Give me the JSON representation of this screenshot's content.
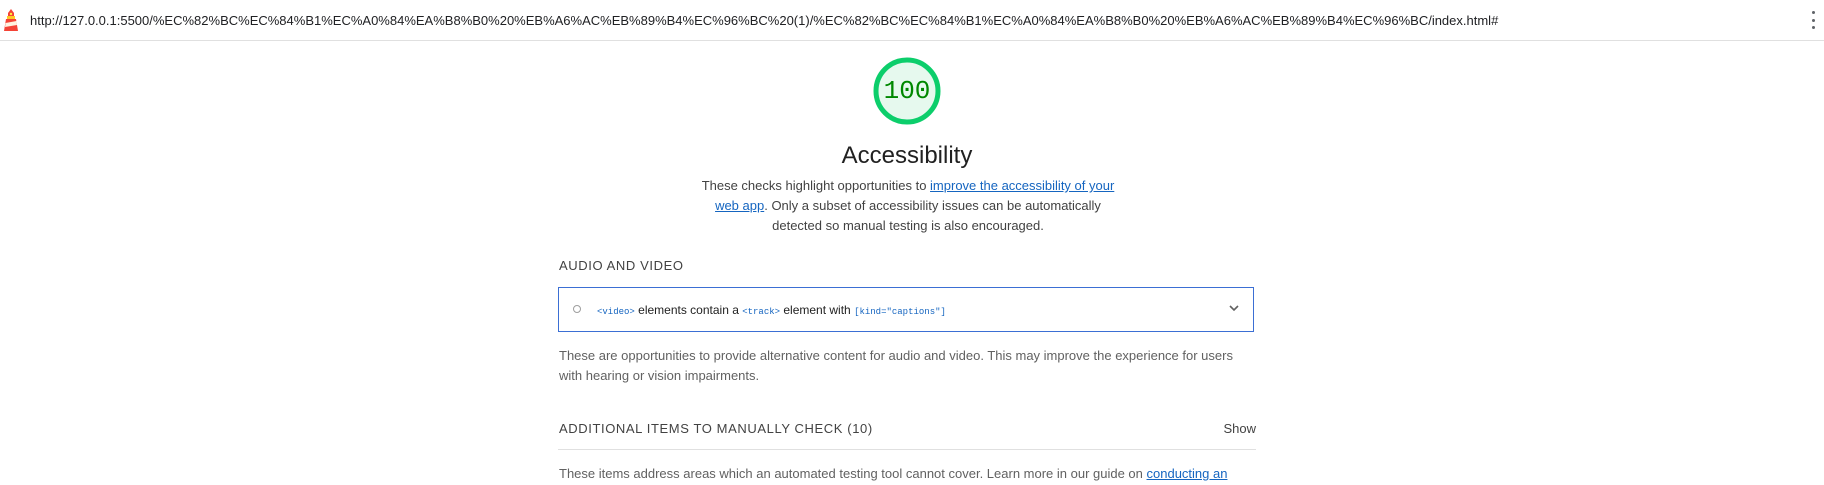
{
  "browser": {
    "url": "http://127.0.0.1:5500/%EC%82%BC%EC%84%B1%EC%A0%84%EA%B8%B0%20%EB%A6%AC%EB%89%B4%EC%96%BC%20(1)/%EC%82%BC%EC%84%B1%EC%A0%84%EA%B8%B0%20%EB%A6%AC%EB%89%B4%EC%96%BC/index.html#",
    "logo_icon": "lighthouse-icon",
    "menu_icon": "more-vert-icon"
  },
  "gauge": {
    "score": "100",
    "score_fraction": 1.0,
    "color": "#0cce6b"
  },
  "category": {
    "title": "Accessibility",
    "desc_before_link": "These checks highlight opportunities to ",
    "desc_link": "improve the accessibility of your web app",
    "desc_after_link": ". Only a subset of accessibility issues can be automatically detected so manual testing is also encouraged."
  },
  "audio_video": {
    "heading": "AUDIO AND VIDEO",
    "audit": {
      "code1": "<video>",
      "text1": " elements contain a ",
      "code2": "<track>",
      "text2": " element with ",
      "code3": "[kind=\"captions\"]",
      "expand_icon": "chevron-down-icon"
    },
    "description": "These are opportunities to provide alternative content for audio and video. This may improve the experience for users with hearing or vision impairments."
  },
  "manual": {
    "heading": "ADDITIONAL ITEMS TO MANUALLY CHECK (10)",
    "show_label": "Show",
    "desc_before_link": "These items address areas which an automated testing tool cannot cover. Learn more in our guide on ",
    "desc_link": "conducting an"
  },
  "colors": {
    "link": "#1565c0",
    "audit_border": "#3b6fd4",
    "pass_green": "#0cce6b",
    "score_text": "#008800"
  }
}
